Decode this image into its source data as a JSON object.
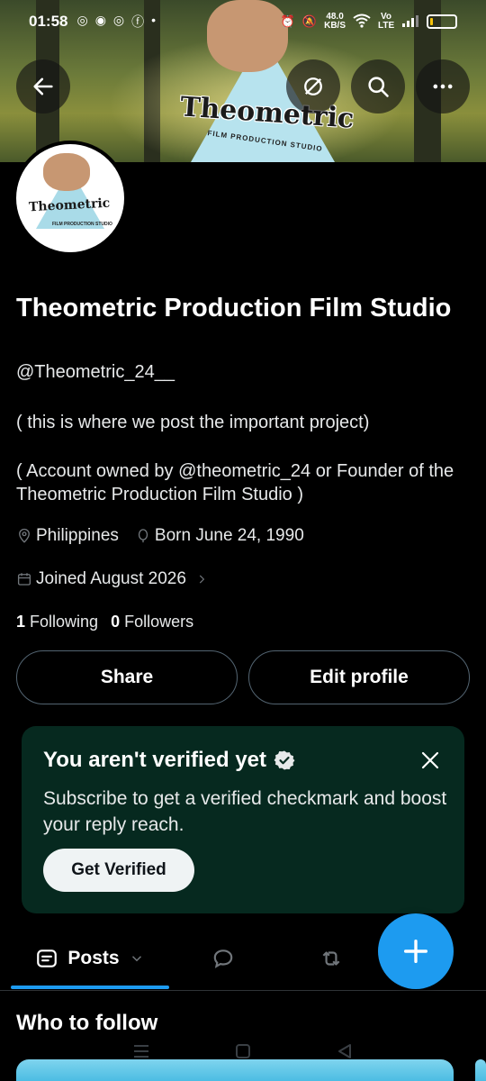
{
  "status_bar": {
    "time": "01:58",
    "speed_value": "48.0",
    "speed_unit": "KB/S",
    "network": "Vo LTE",
    "battery_level": 0.12,
    "battery_color": "#f5c20a"
  },
  "banner": {
    "logo_text": "Theometric",
    "logo_sub": "FILM PRODUCTION STUDIO",
    "buttons": [
      "back-arrow-icon",
      "reply-sync-icon",
      "search-icon",
      "more-icon"
    ]
  },
  "avatar": {
    "logo_text": "Theometric",
    "logo_sub": "FILM PRODUCTION STUDIO"
  },
  "profile": {
    "name": "Theometric Production Film Studio",
    "handle": "@Theometric_24__",
    "bio_line1": "( this is where we post  the important project)",
    "bio_line2": "( Account owned by @theometric_24 or Founder of the Theometric Production Film Studio   )",
    "location": "Philippines",
    "birthday": "Born June 24, 1990",
    "joined": "Joined August 2026",
    "following_count": "1",
    "following_label": "Following",
    "followers_count": "0",
    "followers_label": "Followers"
  },
  "actions": {
    "share_label": "Share",
    "edit_label": "Edit profile"
  },
  "verify_card": {
    "title": "You aren't verified yet",
    "description": "Subscribe to get a verified checkmark and boost your reply reach.",
    "cta_label": "Get Verified"
  },
  "tabs": {
    "posts_label": "Posts"
  },
  "who_to_follow": {
    "title": "Who to follow"
  },
  "colors": {
    "accent": "#1d9bf0",
    "card_bg": "#06291f",
    "border": "#536471"
  }
}
